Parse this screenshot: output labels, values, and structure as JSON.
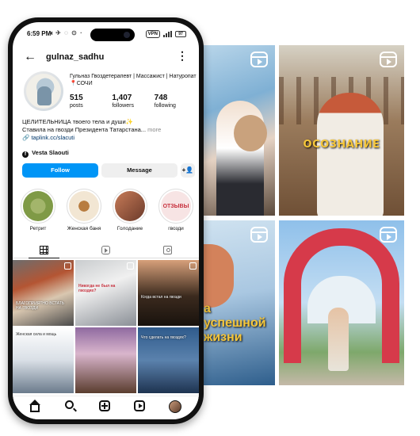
{
  "status_bar": {
    "time": "6:59 PM",
    "left_icons": "◂ ✈ ◌ ⊙ ·",
    "vpn": "VPN",
    "battery": "97"
  },
  "profile": {
    "username": "gulnaz_sadhu",
    "bio_top": "Гульназ Гвоздетерапевт | Массажист | Натуропат 📍СОЧИ",
    "posts_count": "515",
    "posts_label": "posts",
    "followers_count": "1,407",
    "followers_label": "followers",
    "following_count": "748",
    "following_label": "following",
    "desc_line1": "ЦЕЛИТЕЛЬНИЦА твоего тела и души✨",
    "desc_line2": "Ставила на гвозди Президента Татарстана...",
    "desc_more": "more",
    "link": "taplink.cc/slacuti",
    "facebook_name": "Vesta Slaouti"
  },
  "buttons": {
    "follow": "Follow",
    "message": "Message",
    "add_user": "+👤"
  },
  "highlights": [
    {
      "label": "Ретрит"
    },
    {
      "label": "Женская баня"
    },
    {
      "label": "Голодание"
    },
    {
      "label": "гвозди",
      "cover_text": "ОТЗЫВЫ"
    }
  ],
  "tiles": {
    "caption_awareness": "ОСОЗНАНИЕ",
    "caption_life": "а успешной жизни"
  },
  "posts": {
    "p1_caption": "БЛАГОПРИЯТНО ВСТАТЬ НА ГВОЗДИ",
    "p2_caption": "Никогда не был на гвоздях?",
    "p3_caption": "Когда встал на гвозди",
    "p4_caption": "Женская сила и мощь",
    "p6_caption": "Что сделать на гвоздях?"
  }
}
